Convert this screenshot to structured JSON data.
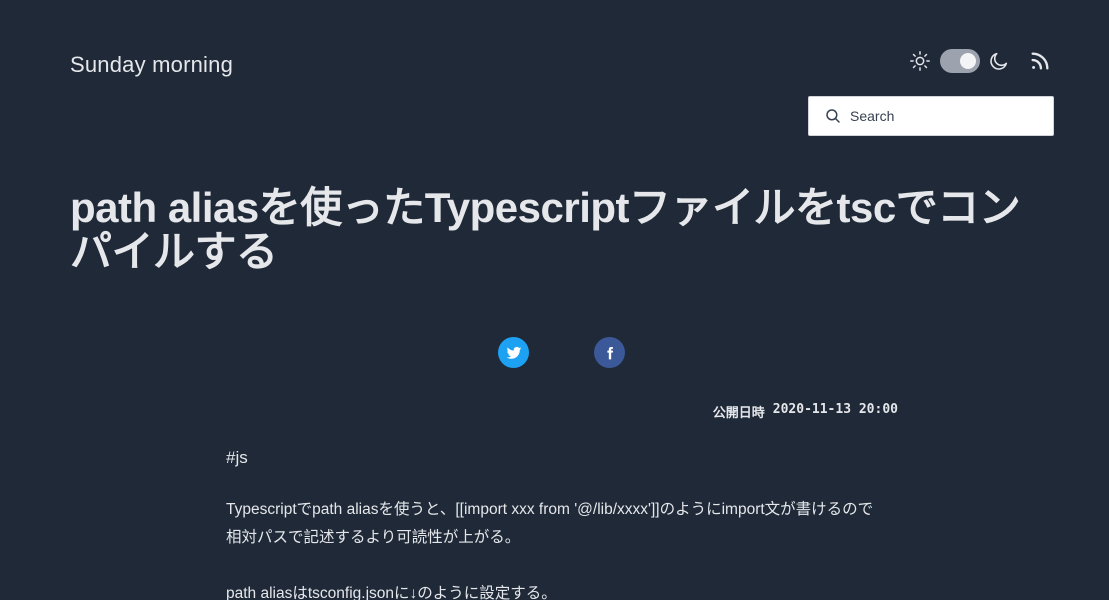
{
  "site": {
    "title": "Sunday morning"
  },
  "header": {
    "icons": {
      "theme_light": "sun-icon",
      "theme_dark": "moon-icon",
      "feed": "rss-icon"
    },
    "theme_toggle_state": "dark"
  },
  "search": {
    "placeholder": "Search",
    "icon": "search-icon"
  },
  "post": {
    "title": "path aliasを使ったTypescriptファイルをtscでコンパイルする",
    "published_label": "公開日時",
    "published_date": "2020-11-13 20:00",
    "tag": "#js",
    "paragraphs": [
      "Typescriptでpath aliasを使うと、[[import xxx from '@/lib/xxxx']]のようにimport文が書けるので相対パスで記述するより可読性が上がる。",
      "path aliasはtsconfig.jsonに↓のように設定する。"
    ]
  },
  "share": {
    "twitter_icon": "twitter-icon",
    "facebook_icon": "facebook-icon"
  },
  "colors": {
    "background": "#1f2937",
    "text": "#e5e7eb",
    "twitter": "#1da1f2",
    "facebook": "#3b5998",
    "toggle": "#9ca3af"
  }
}
